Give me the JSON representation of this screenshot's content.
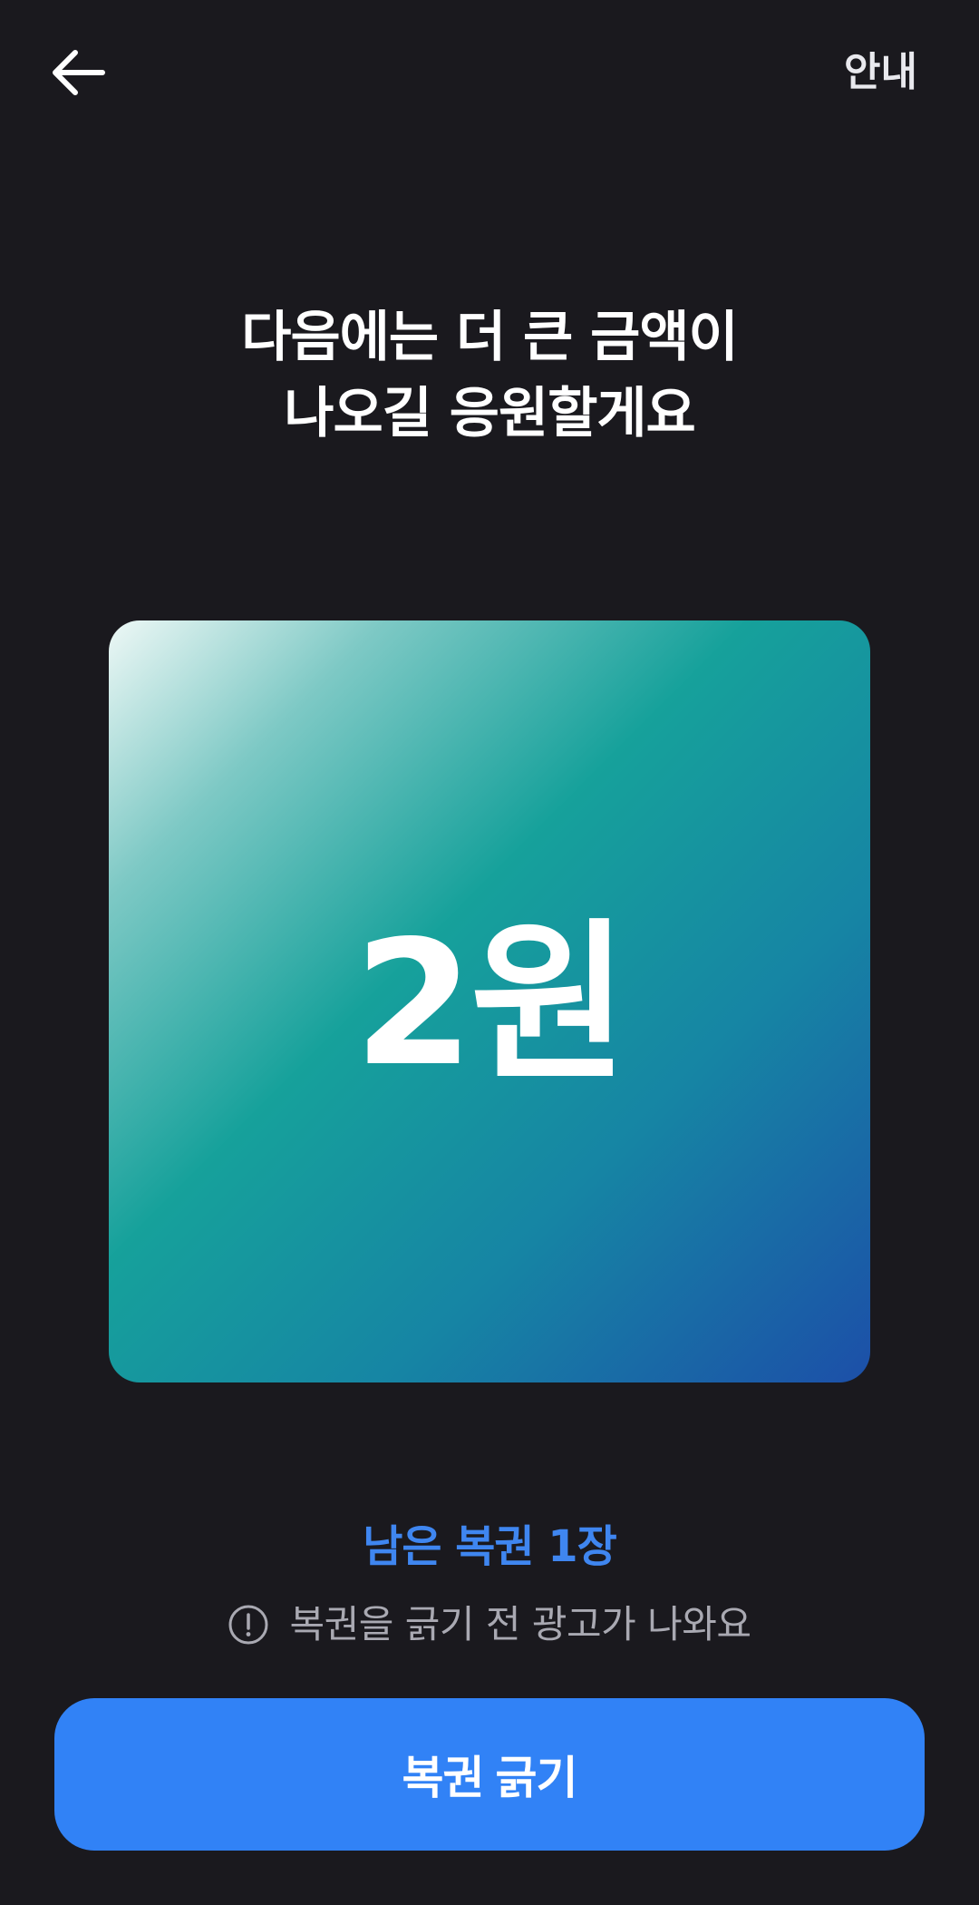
{
  "header": {
    "back_icon": "arrow-left-icon",
    "guide_label": "안내"
  },
  "headline": {
    "line1": "다음에는 더 큰 금액이",
    "line2": "나오길 응원할게요"
  },
  "prize": {
    "amount_label": "2원",
    "gradient_colors": [
      "#eef8f6",
      "#16a19b",
      "#1c4fa8"
    ]
  },
  "status": {
    "remaining_label": "남은 복권 1장",
    "notice_icon": "exclamation-circle-icon",
    "notice_text": "복권을 긁기 전 광고가 나와요"
  },
  "action": {
    "scratch_label": "복권 긁기"
  },
  "colors": {
    "background": "#1a191e",
    "accent": "#3182f6",
    "remaining_text": "#3f86f0",
    "muted_text": "#a9a9b2"
  }
}
